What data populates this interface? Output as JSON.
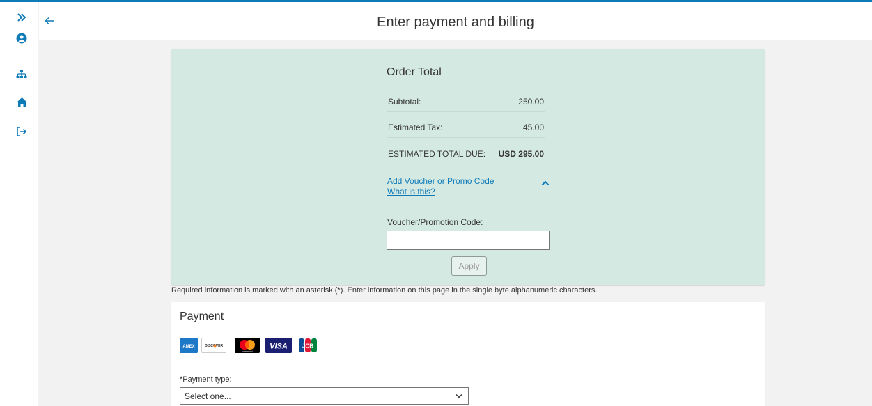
{
  "app": {
    "accent": "#0e7ab8",
    "panel_color": "#d4e9e2"
  },
  "sidebar": {
    "icons": [
      "expand-icon",
      "user-icon",
      "sitemap-icon",
      "home-icon",
      "logout-icon"
    ]
  },
  "header": {
    "title": "Enter payment and billing"
  },
  "order": {
    "title": "Order Total",
    "subtotal_label": "Subtotal:",
    "subtotal_value": "250.00",
    "tax_label": "Estimated Tax:",
    "tax_value": "45.00",
    "total_label": "ESTIMATED TOTAL DUE:",
    "total_value": "USD 295.00",
    "voucher_link": "Add Voucher or Promo Code",
    "what_link": "What is this?",
    "voucher_label": "Voucher/Promotion Code:",
    "voucher_value": "",
    "apply_label": "Apply"
  },
  "required_note": "Required information is marked with an asterisk (*). Enter information on this page in the single byte alphanumeric characters.",
  "payment": {
    "title": "Payment",
    "cards": [
      {
        "name": "amex-card-icon",
        "text": "AMEX"
      },
      {
        "name": "discover-card-icon",
        "text": "DISCOVER"
      },
      {
        "name": "mastercard-card-icon",
        "text": "mastercard"
      },
      {
        "name": "visa-card-icon",
        "text": "VISA"
      },
      {
        "name": "jcb-card-icon",
        "text": "JCB"
      }
    ],
    "type_label": "*Payment type:",
    "type_selected": "Select one..."
  }
}
